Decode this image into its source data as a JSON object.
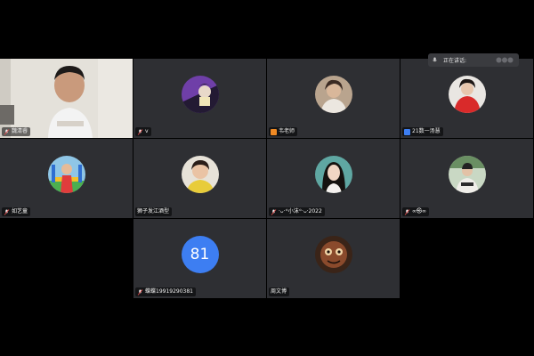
{
  "meeting": {
    "speaking_label": "正在讲话:",
    "colors": {
      "background": "#000000",
      "tile": "#2e2f33",
      "number_avatar": "#3d7ef2",
      "host_badge": "#f08a24",
      "cohost_badge": "#3d7ef2"
    }
  },
  "participants": [
    {
      "name": "魏清睿",
      "type": "camera"
    },
    {
      "name": "v",
      "type": "avatar",
      "avatar": "anime-avatar"
    },
    {
      "name": "韦老师",
      "type": "avatar",
      "avatar": "woman-photo-avatar",
      "badge": "host-badge-icon"
    },
    {
      "name": "21数一汤慧",
      "type": "avatar",
      "avatar": "red-outfit-avatar",
      "badge": "cohost-badge-icon"
    },
    {
      "name": "如艺童",
      "type": "avatar",
      "avatar": "child-playground-avatar"
    },
    {
      "name": "狮子发江酒型",
      "type": "avatar",
      "avatar": "smiling-woman-avatar"
    },
    {
      "name": "·ᴗ·꙳小沫꙳·ᴗ·2022",
      "type": "avatar",
      "avatar": "dark-hair-woman-avatar"
    },
    {
      "name": "∞㉿∞",
      "type": "avatar",
      "avatar": "figure-portrait-avatar"
    },
    {
      "name": "蝶蝶19919290381",
      "type": "number",
      "number": "81"
    },
    {
      "name": "周文博",
      "type": "avatar",
      "avatar": "brown-character-avatar"
    }
  ]
}
